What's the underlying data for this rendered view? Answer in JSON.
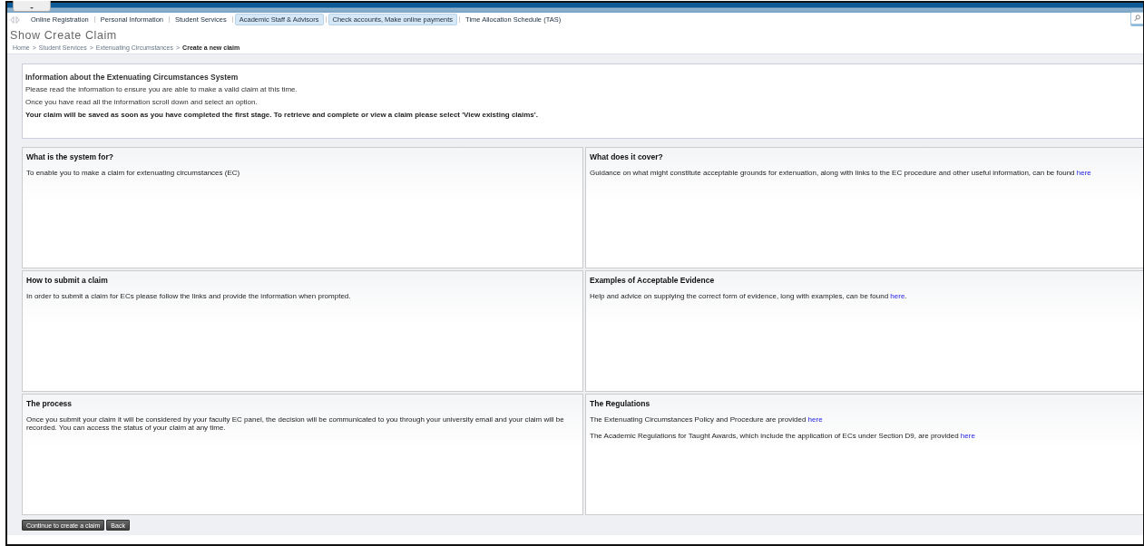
{
  "nav": {
    "items": [
      {
        "label": "Online Registration",
        "highlighted": false
      },
      {
        "label": "Personal Information",
        "highlighted": false
      },
      {
        "label": "Student Services",
        "highlighted": false
      },
      {
        "label": "Academic Staff & Advisors",
        "highlighted": true
      },
      {
        "label": "Check accounts, Make online payments",
        "highlighted": true
      },
      {
        "label": "Time Allocation Schedule (TAS)",
        "highlighted": false
      }
    ]
  },
  "page_title": "Show Create Claim",
  "breadcrumb": {
    "separator": ">",
    "items": [
      {
        "label": "Home",
        "current": false
      },
      {
        "label": "Student Services",
        "current": false
      },
      {
        "label": "Extenuating Circumstances",
        "current": false
      },
      {
        "label": "Create a new claim",
        "current": true
      }
    ]
  },
  "info": {
    "heading": "Information about the Extenuating Circumstances System",
    "lines": [
      {
        "text": "Please read the information to ensure you are able to make a valid claim at this time.",
        "bold": false
      },
      {
        "text": "Once you have read all the information scroll down and select an option.",
        "bold": false
      },
      {
        "text": "Your claim will be saved as soon as you have completed the first stage. To retrieve and complete or view a claim please select 'View existing claims'.",
        "bold": true
      }
    ]
  },
  "panels": [
    {
      "heading": "What is the system for?",
      "paragraphs": [
        {
          "text": "To enable you to make a claim for extenuating circumstances (EC)"
        }
      ]
    },
    {
      "heading": "What does it cover?",
      "paragraphs": [
        {
          "text": "Guidance on what might constitute acceptable grounds for extenuation, along with links to the EC procedure and other useful information, can be found",
          "link": "here"
        }
      ]
    },
    {
      "heading": "How to submit a claim",
      "paragraphs": [
        {
          "text": "In order to submit a claim for ECs please follow the links and provide the information when prompted."
        }
      ]
    },
    {
      "heading": "Examples of Acceptable Evidence",
      "paragraphs": [
        {
          "text": "Help and advice on supplying the correct form of evidence, long with examples, can be found",
          "link": "here",
          "after": "."
        }
      ]
    },
    {
      "heading": "The process",
      "paragraphs": [
        {
          "text": "Once you submit your claim it will be considered by your faculty EC panel, the decision will be communicated to you through your university email and your claim will be recorded. You can access the status of your claim at any time."
        }
      ]
    },
    {
      "heading": "The Regulations",
      "paragraphs": [
        {
          "text": "The Extenuating Circumstances Policy and Procedure are provided",
          "link": "here"
        },
        {
          "text": "The Academic Regulations for Taught Awards, which include the application of ECs under Section D9, are provided",
          "link": "here"
        }
      ]
    }
  ],
  "buttons": [
    "Continue to create a claim",
    "Back"
  ]
}
